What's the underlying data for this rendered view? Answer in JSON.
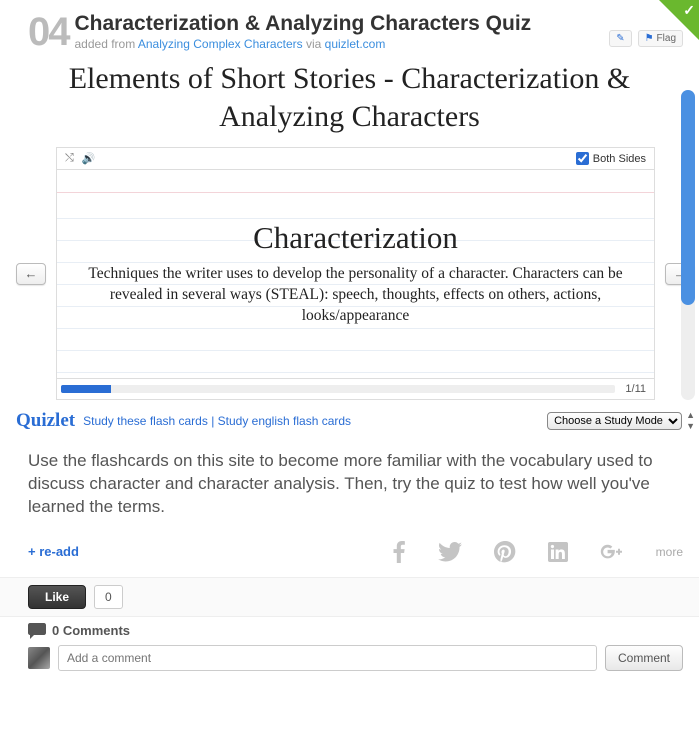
{
  "header": {
    "number": "04",
    "title": "Characterization & Analyzing Characters Quiz",
    "added_from": "added from ",
    "source_link": "Analyzing Complex Characters",
    "via": " via ",
    "site_link": "quizlet.com",
    "flag_label": "Flag"
  },
  "main_title": "Elements of Short Stories - Characterization & Analyzing Characters",
  "card": {
    "both_sides_label": "Both Sides",
    "term": "Characterization",
    "definition": "Techniques the writer uses to develop the personality of a character. Characters can be revealed in several ways (STEAL): speech, thoughts, effects on others, actions, looks/appearance",
    "counter": "1/11"
  },
  "quizlet": {
    "logo": "Quizlet",
    "study_link1": "Study these flash cards",
    "separator": " | ",
    "study_link2": "Study english flash cards",
    "mode_label": "Choose a Study Mode"
  },
  "description": "Use the flashcards on this site to become more familiar with the vocabulary used to discuss character and character analysis.  Then, try the quiz to test how well you've learned the terms.",
  "actions": {
    "readd": "+ re-add",
    "more": "more",
    "like": "Like",
    "like_count": "0"
  },
  "comments": {
    "count_label": "0 Comments",
    "placeholder": "Add a comment",
    "button": "Comment"
  }
}
